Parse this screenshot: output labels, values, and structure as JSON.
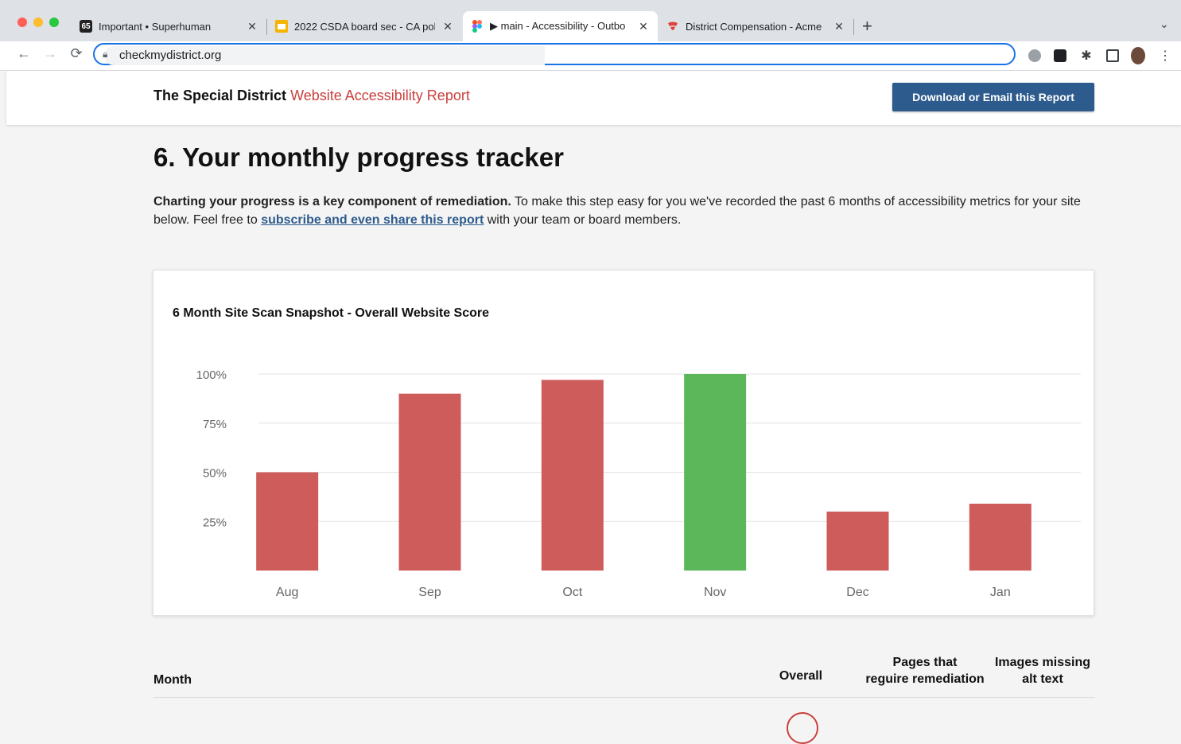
{
  "browser": {
    "tabs": [
      {
        "title": "Important • Superhuman",
        "badge": "65"
      },
      {
        "title": "2022 CSDA board sec - CA pol"
      },
      {
        "title": "▶ main - Accessibility - Outbo"
      },
      {
        "title": "District Compensation - Acme"
      }
    ],
    "url": "checkmydistrict.org"
  },
  "header": {
    "brand_bold": "The Special District",
    "brand_accent": "Website Accessibility Report",
    "download_label": "Download or Email this Report"
  },
  "section": {
    "title": "6. Your monthly progress tracker",
    "intro_bold": "Charting your progress is a key component of remediation.",
    "intro_text": " To make this step easy for you we've recorded the past 6 months of accessibility metrics for your site below. Feel free to ",
    "intro_link": "subscribe and even share this report",
    "intro_end": " with your team or board members."
  },
  "chart_data": {
    "type": "bar",
    "title": "6 Month Site Scan Snapshot - Overall Website Score",
    "categories": [
      "Aug",
      "Sep",
      "Oct",
      "Nov",
      "Dec",
      "Jan"
    ],
    "values": [
      50,
      90,
      97,
      100,
      30,
      34
    ],
    "yticks": [
      "25%",
      "50%",
      "75%",
      "100%"
    ],
    "ylim": [
      0,
      100
    ],
    "colors": {
      "default": "#cd5c5a",
      "highlight": "#5cb65a"
    },
    "highlight_index": 3,
    "grid": true
  },
  "table": {
    "headers": {
      "month": "Month",
      "overall": "Overall",
      "pages": "Pages that\nreguire remediation",
      "images": "Images missing\nalt text"
    }
  }
}
